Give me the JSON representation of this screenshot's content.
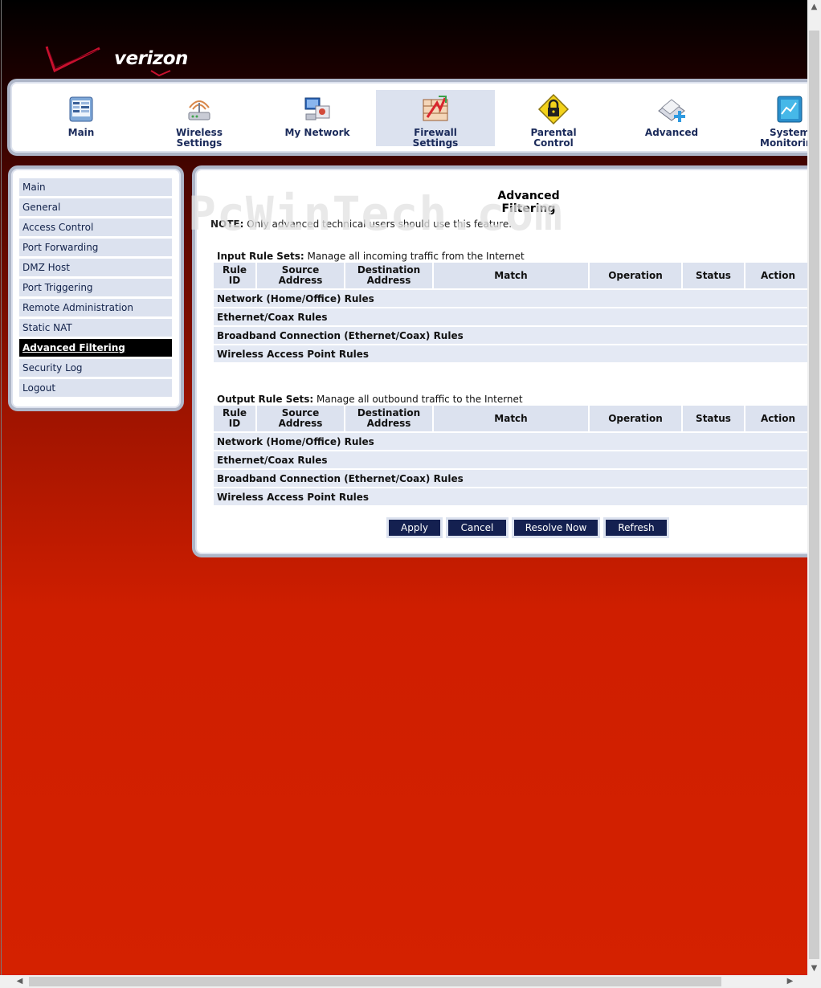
{
  "brand": {
    "logo_text": "verizon"
  },
  "topnav": [
    {
      "label1": "Main",
      "label2": "",
      "icon": "main-icon",
      "active": false
    },
    {
      "label1": "Wireless",
      "label2": "Settings",
      "icon": "wireless-icon",
      "active": false
    },
    {
      "label1": "My Network",
      "label2": "",
      "icon": "my-network-icon",
      "active": false
    },
    {
      "label1": "Firewall",
      "label2": "Settings",
      "icon": "firewall-icon",
      "active": true
    },
    {
      "label1": "Parental",
      "label2": "Control",
      "icon": "parental-lock-icon",
      "active": false
    },
    {
      "label1": "Advanced",
      "label2": "",
      "icon": "advanced-icon",
      "active": false
    },
    {
      "label1": "System",
      "label2": "Monitoring",
      "icon": "system-monitoring-icon",
      "active": false
    }
  ],
  "sidebar": {
    "items": [
      {
        "label": "Main"
      },
      {
        "label": "General"
      },
      {
        "label": "Access Control"
      },
      {
        "label": "Port Forwarding"
      },
      {
        "label": "DMZ Host"
      },
      {
        "label": "Port Triggering"
      },
      {
        "label": "Remote Administration"
      },
      {
        "label": "Static NAT"
      },
      {
        "label": "Advanced Filtering"
      },
      {
        "label": "Security Log"
      },
      {
        "label": "Logout"
      }
    ],
    "active_index": 8
  },
  "watermark": "PcWinTech.com",
  "content": {
    "title": "Advanced Filtering",
    "note_label": "NOTE:",
    "note_text": " Only advanced technical users should use this feature.",
    "input": {
      "label": "Input Rule Sets:",
      "desc": " Manage all incoming traffic from the Internet"
    },
    "output": {
      "label": "Output Rule Sets:",
      "desc": " Manage all outbound traffic to the Internet"
    },
    "columns": {
      "rule_id_1": "Rule",
      "rule_id_2": "ID",
      "source_1": "Source",
      "source_2": "Address",
      "dest_1": "Destination",
      "dest_2": "Address",
      "match": "Match",
      "operation": "Operation",
      "status": "Status",
      "action": "Action"
    },
    "groups": [
      "Network (Home/Office) Rules",
      "Ethernet/Coax Rules",
      "Broadband Connection (Ethernet/Coax) Rules",
      "Wireless Access Point Rules"
    ],
    "buttons": {
      "apply": "Apply",
      "cancel": "Cancel",
      "resolve": "Resolve Now",
      "refresh": "Refresh"
    }
  },
  "scrollbar": {
    "up": "▲",
    "down": "▼",
    "left": "◀",
    "right": "▶"
  }
}
